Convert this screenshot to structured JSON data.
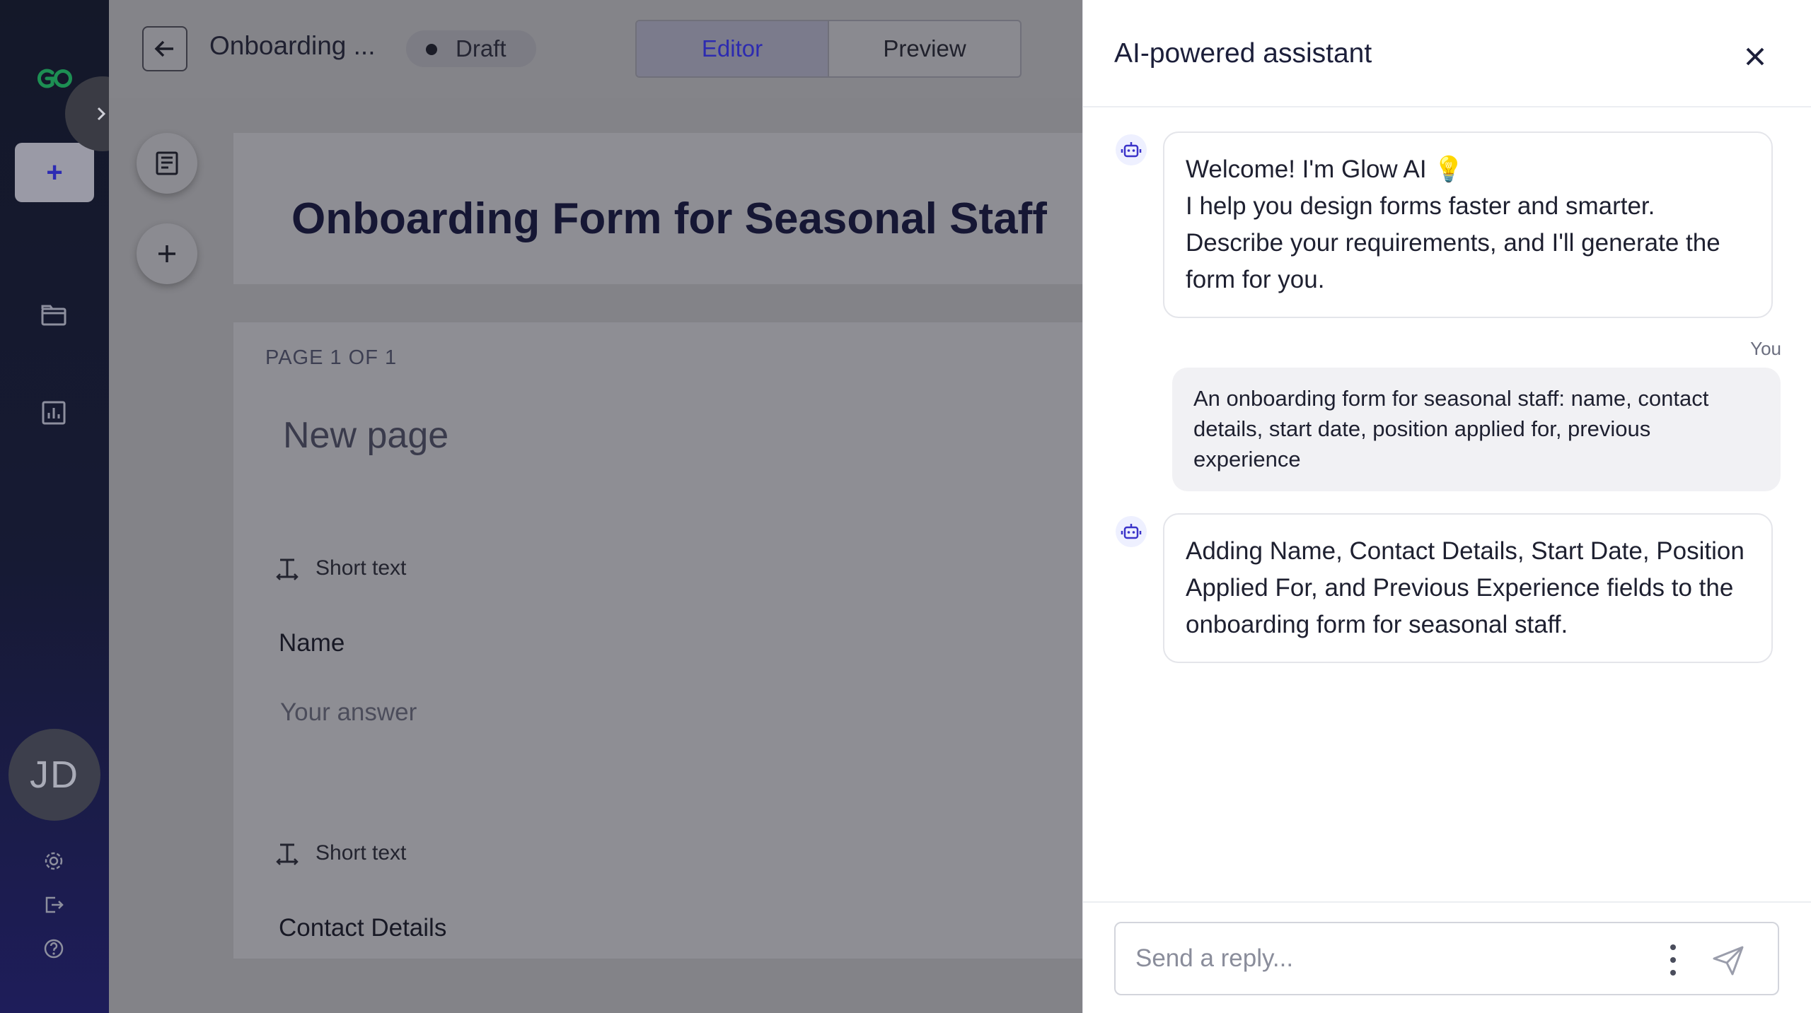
{
  "rail": {
    "avatar_initials": "JD",
    "icons": [
      "logo-icon",
      "expand-chevron-icon",
      "add-icon",
      "folder-icon",
      "analytics-icon",
      "settings-icon",
      "logout-icon",
      "help-icon"
    ],
    "new_label": "+"
  },
  "topbar": {
    "doc_title": "Onboarding ...",
    "status": "Draft",
    "tabs": [
      {
        "label": "Editor",
        "active": true
      },
      {
        "label": "Preview",
        "active": false
      }
    ]
  },
  "form": {
    "title": "Onboarding Form for Seasonal Staff",
    "page_label": "PAGE 1 OF 1",
    "page_name": "New page",
    "fields": [
      {
        "type": "Short text",
        "name": "Name",
        "placeholder": "Your answer"
      },
      {
        "type": "Short text",
        "name": "Contact Details"
      }
    ]
  },
  "assistant": {
    "title": "AI-powered assistant",
    "messages": [
      {
        "role": "bot",
        "text_line1": "Welcome! I'm Glow AI 💡",
        "text_rest": "I help you design forms faster and smarter. Describe your requirements, and I'll generate the form for you."
      },
      {
        "role": "user",
        "label": "You",
        "text": "An onboarding form for seasonal staff: name, contact details, start date, position applied for, previous experience"
      },
      {
        "role": "bot",
        "text": "Adding Name, Contact Details, Start Date, Position Applied For, and Previous Experience fields to the onboarding form for seasonal staff."
      }
    ],
    "reply_placeholder": "Send a reply..."
  },
  "colors": {
    "accent": "#2d2bb0",
    "rail_top": "#141829",
    "rail_bottom": "#1e1d5a",
    "overlay": "#838388",
    "logo_green": "#1fa35c"
  }
}
